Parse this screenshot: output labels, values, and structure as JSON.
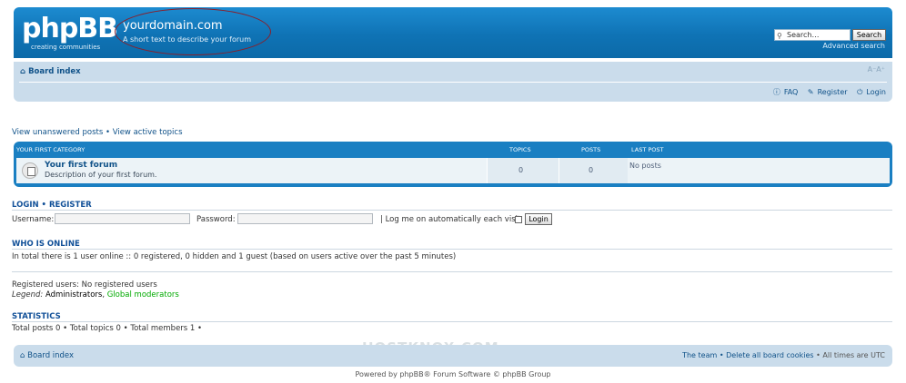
{
  "header": {
    "logo_text": "phpBB",
    "logo_tagline": "creating   communities",
    "site_title": "yourdomain.com",
    "site_description": "A short text to describe your forum",
    "search_placeholder": "Search…",
    "search_button": "Search",
    "advanced_search": "Advanced search"
  },
  "navbar": {
    "home_label": "Board index",
    "font_size_control": "A⁻A⁺",
    "faq": "FAQ",
    "register": "Register",
    "login": "Login"
  },
  "search_links": {
    "unanswered": "View unanswered posts",
    "separator": "•",
    "active": "View active topics"
  },
  "forum_list": {
    "category": "YOUR FIRST CATEGORY",
    "col_topics": "TOPICS",
    "col_posts": "POSTS",
    "col_last_post": "LAST POST",
    "forums": [
      {
        "name": "Your first forum",
        "description": "Description of your first forum.",
        "topics": "0",
        "posts": "0",
        "last_post": "No posts"
      }
    ]
  },
  "login": {
    "title": "LOGIN • REGISTER",
    "username_label": "Username:",
    "password_label": "Password:",
    "remember_label": "| Log me on automatically each visit",
    "button": "Login"
  },
  "online": {
    "title": "WHO IS ONLINE",
    "summary": "In total there is 1 user online :: 0 registered, 0 hidden and 1 guest (based on users active over the past 5 minutes)",
    "registered": "Registered users: No registered users",
    "legend_label": "Legend:",
    "legend_admins": "Administrators",
    "legend_sep": ",",
    "legend_mods": "Global moderators"
  },
  "statistics": {
    "title": "STATISTICS",
    "text": "Total posts 0 • Total topics 0 • Total members 1 •"
  },
  "footer": {
    "home_label": "Board index",
    "team": "The team",
    "sep1": "•",
    "delete_cookies": "Delete all board cookies",
    "sep2": "•",
    "times": "All times are UTC",
    "watermark": "HOSTKNOX.COM",
    "powered": "Powered by phpBB® Forum Software © phpBB Group"
  },
  "colors": {
    "header_blue": "#1a7fc2",
    "navbar_bg": "#cadceb",
    "link": "#105289",
    "admins": "#000000",
    "mods": "#00aa00",
    "highlight_ellipse": "#8a1f2a"
  }
}
